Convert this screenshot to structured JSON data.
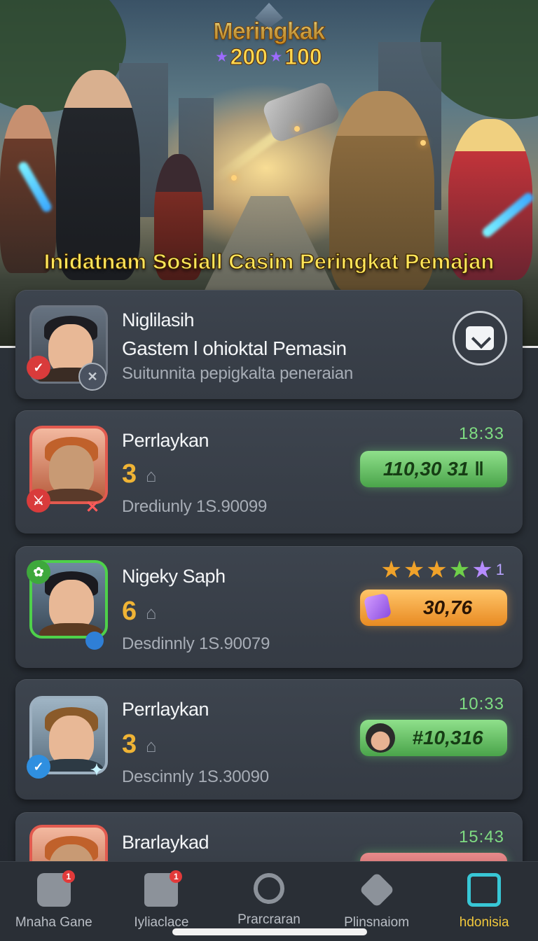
{
  "hero": {
    "logo_title": "Meringkak",
    "logo_num_left": "200",
    "logo_num_right": "100",
    "banner_text": "Inidatnam Sosiall Casim Peringkat Pemajan"
  },
  "header_card": {
    "title": "Niglilasih",
    "subtitle": "Gastem l ohioktal Pemasin",
    "description": "Suitunnita pepigkalta peneraian",
    "action_icon": "export-icon"
  },
  "players": [
    {
      "name": "Perrlaykan",
      "rank": "3",
      "description": "Drediunly 1S.90099",
      "time": "18:33",
      "score": "110,30 31 ‖",
      "pill_style": "green",
      "avatar_theme": "werewolf"
    },
    {
      "name": "Nigeky Saph",
      "rank": "6",
      "description": "Desdinnly 1S.90079",
      "stars_count": "1",
      "score": "30,76",
      "pill_style": "orange",
      "avatar_theme": "hero"
    },
    {
      "name": "Perrlaykan",
      "rank": "3",
      "description": "Descinnly 1S.30090",
      "time": "10:33",
      "score": "#10,316",
      "pill_style": "green",
      "avatar_theme": "elf"
    },
    {
      "name": "Brarlaykad",
      "time": "15:43",
      "avatar_theme": "werewolf"
    }
  ],
  "nav": {
    "items": [
      {
        "label": "Mnaha Gane",
        "icon": "dice-icon",
        "badge": "1"
      },
      {
        "label": "Iyliaclace",
        "icon": "checklist-icon",
        "badge": "1"
      },
      {
        "label": "Prarcraran",
        "icon": "search-icon"
      },
      {
        "label": "Plinsnaiom",
        "icon": "layers-icon"
      },
      {
        "label": "hdonisia",
        "icon": "home-icon"
      }
    ],
    "active_index": 4
  },
  "colors": {
    "accent_gold": "#f0b435",
    "accent_green": "#7fdc82",
    "nav_active": "#f2c83c",
    "card_bg": "#3d444e"
  }
}
